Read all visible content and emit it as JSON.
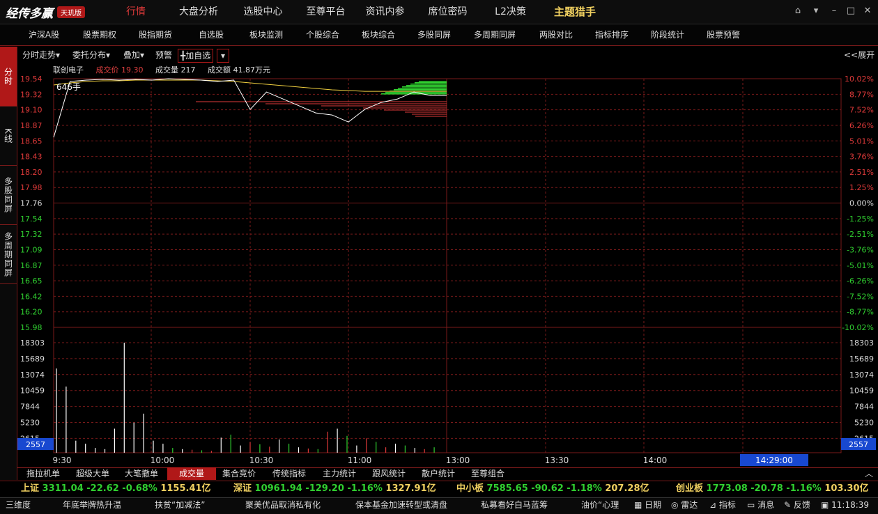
{
  "app": {
    "logo_text": "经传多赢",
    "edition_badge": "天玑版"
  },
  "top_nav": [
    "行情",
    "大盘分析",
    "选股中心",
    "至尊平台",
    "资讯内参",
    "席位密码",
    "L2决策",
    "主题猎手"
  ],
  "window_controls": {
    "home": "⌂",
    "dropdown": "▾",
    "minimize": "–",
    "maximize": "□",
    "close": "✕"
  },
  "menu": [
    "沪深A股",
    "股票期权",
    "股指期货",
    "自选股",
    "板块监测",
    "个股综合",
    "板块综合",
    "多股同屏",
    "多周期同屏",
    "两股对比",
    "指标排序",
    "阶段统计",
    "股票预警"
  ],
  "side_tabs": [
    "分时",
    "K线",
    "多股同屏",
    "多周期同屏"
  ],
  "toolbar": {
    "timeshare": "分时走势▾",
    "orders": "委托分布▾",
    "overlay": "叠加▾",
    "alert": "预警",
    "add_watch": "╋加自选",
    "add_watch_dd": "▾",
    "expand": "<<展开"
  },
  "stock": {
    "name": "联创电子",
    "price_label": "成交价",
    "price": "19.30",
    "vol_label": "成交量",
    "vol": "217",
    "amt_label": "成交额",
    "amt": "41.87万元",
    "order_qty": "646手"
  },
  "price_axis": [
    "19.54",
    "19.32",
    "19.10",
    "18.87",
    "18.65",
    "18.43",
    "18.20",
    "17.98",
    "17.76",
    "17.54",
    "17.32",
    "17.09",
    "16.87",
    "16.65",
    "16.42",
    "16.20",
    "15.98"
  ],
  "pct_axis": [
    "10.02%",
    "8.77%",
    "7.52%",
    "6.26%",
    "5.01%",
    "3.76%",
    "2.51%",
    "1.25%",
    "0.00%",
    "-1.25%",
    "-2.51%",
    "-3.76%",
    "-5.01%",
    "-6.26%",
    "-7.52%",
    "-8.77%",
    "-10.02%"
  ],
  "vol_axis": [
    "18303",
    "15689",
    "13074",
    "10459",
    "7844",
    "5230",
    "2615"
  ],
  "vol_current": "2557",
  "time_axis": [
    "9:30",
    "10:00",
    "10:30",
    "11:00",
    "13:00",
    "13:30",
    "14:00"
  ],
  "time_cursor": "14:29:00",
  "colors": {
    "up": "#e03a3a",
    "down": "#30d030",
    "grid": "#7a1a1a",
    "price_line": "#ffffff",
    "avg_line": "#f0d040",
    "accent_blue": "#1848d0"
  },
  "chart_data": {
    "type": "line",
    "title": "",
    "xlabel": "",
    "ylabel": "",
    "ylim": [
      15.98,
      19.54
    ],
    "x": [
      "9:30",
      "9:35",
      "9:40",
      "9:45",
      "9:50",
      "9:55",
      "10:00",
      "10:05",
      "10:10",
      "10:15",
      "10:20",
      "10:25",
      "10:30",
      "10:35",
      "10:40",
      "10:45",
      "10:50",
      "10:55",
      "11:00",
      "11:05",
      "11:10",
      "11:15",
      "11:20",
      "11:25",
      "11:30"
    ],
    "series": [
      {
        "name": "",
        "values": [
          18.7,
          19.5,
          19.52,
          19.53,
          19.52,
          19.53,
          19.52,
          19.54,
          19.53,
          19.52,
          19.5,
          19.52,
          19.1,
          19.35,
          19.25,
          19.15,
          19.05,
          19.02,
          18.92,
          19.1,
          19.2,
          19.25,
          19.35,
          19.3,
          19.3
        ]
      },
      {
        "name": "",
        "values": [
          19.45,
          19.48,
          19.5,
          19.51,
          19.51,
          19.52,
          19.52,
          19.52,
          19.52,
          19.52,
          19.51,
          19.5,
          19.48,
          19.46,
          19.44,
          19.42,
          19.4,
          19.38,
          19.37,
          19.36,
          19.36,
          19.36,
          19.36,
          19.36,
          19.36
        ]
      }
    ],
    "volume": [
      14000,
      11000,
      2000,
      1500,
      800,
      600,
      4000,
      18303,
      5000,
      6500,
      2000,
      1500,
      800,
      600,
      500,
      400,
      300,
      2500,
      3000,
      1200,
      1800,
      1400,
      1000,
      2200,
      1500,
      900,
      700,
      600,
      3500,
      4000,
      2800,
      1200,
      2400,
      1800,
      900,
      1500,
      1200,
      800,
      600,
      900
    ]
  }
}
